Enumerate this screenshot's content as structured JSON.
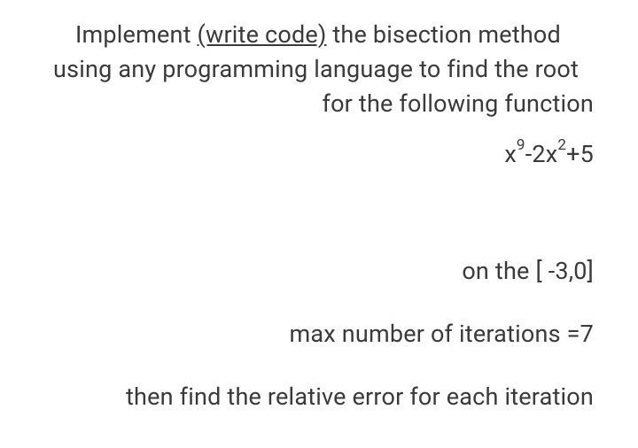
{
  "problem": {
    "line1_prefix": "Implement ",
    "line1_underline": "(write code)",
    "line1_suffix": "  the  bisection method",
    "line2": "using any programming language to find the root",
    "line3": "for the following function",
    "equation": {
      "part1": "x",
      "exp1": "9",
      "part2": "-2x",
      "exp2": "2",
      "part3": "+5"
    },
    "interval": "on the [ -3,0]",
    "max_iterations": "max number of iterations =7",
    "relative_error": "then find the relative error for each iteration"
  }
}
